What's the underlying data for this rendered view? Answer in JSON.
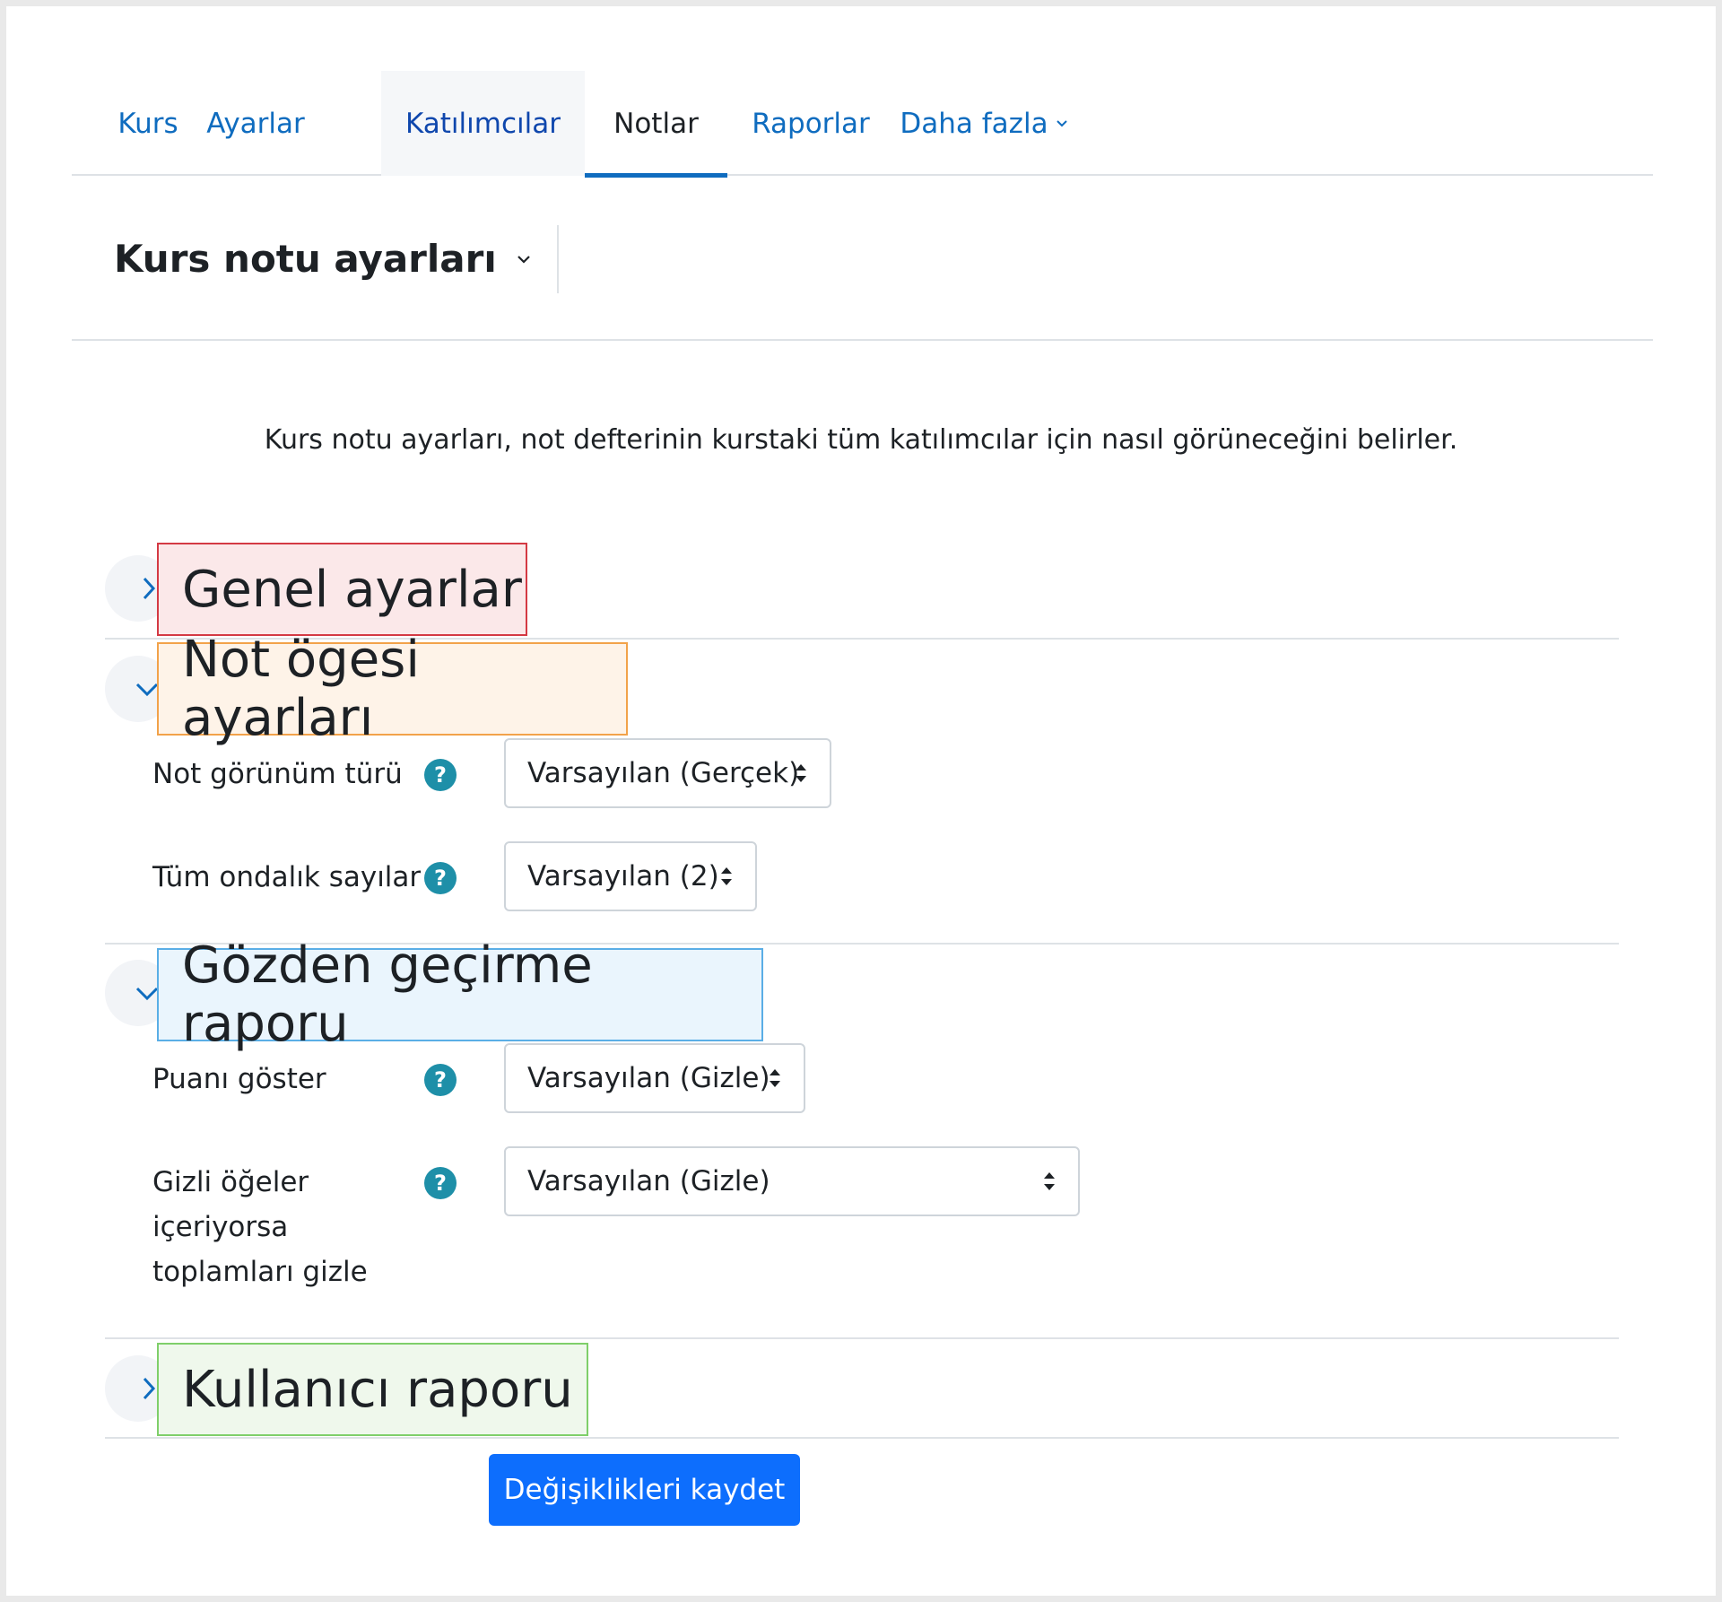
{
  "nav": {
    "items": [
      {
        "label": "Kurs"
      },
      {
        "label": "Ayarlar"
      },
      {
        "label": "Katılımcılar"
      },
      {
        "label": "Notlar"
      },
      {
        "label": "Raporlar"
      },
      {
        "label": "Daha fazla"
      }
    ],
    "active": "Notlar"
  },
  "page": {
    "title": "Kurs notu ayarları",
    "intro": "Kurs notu ayarları, not defterinin kurstaki tüm katılımcılar için nasıl görüneceğini belirler."
  },
  "sections": {
    "general": {
      "title": "Genel ayarlar",
      "expanded": false
    },
    "grade_item": {
      "title": "Not ögesi ayarları",
      "expanded": true,
      "fields": [
        {
          "label": "Not görünüm türü",
          "value": "Varsayılan (Gerçek)"
        },
        {
          "label": "Tüm ondalık sayılar",
          "value": "Varsayılan (2)"
        }
      ]
    },
    "overview": {
      "title": "Gözden geçirme raporu",
      "expanded": true,
      "fields": [
        {
          "label": "Puanı göster",
          "value": "Varsayılan (Gizle)"
        },
        {
          "label": "Gizli öğeler içeriyorsa toplamları gizle",
          "value": "Varsayılan (Gizle)"
        }
      ]
    },
    "user": {
      "title": "Kullanıcı raporu",
      "expanded": false
    }
  },
  "help_icon_glyph": "?",
  "buttons": {
    "save": "Değişiklikleri kaydet"
  },
  "colors": {
    "link": "#0f6cbf",
    "primary_button": "#0d6efd",
    "help_icon": "#1e8fa8",
    "highlight_red": "#d43a44",
    "highlight_orange": "#f2a24a",
    "highlight_blue": "#5aaee6",
    "highlight_green": "#7fcf6a"
  }
}
